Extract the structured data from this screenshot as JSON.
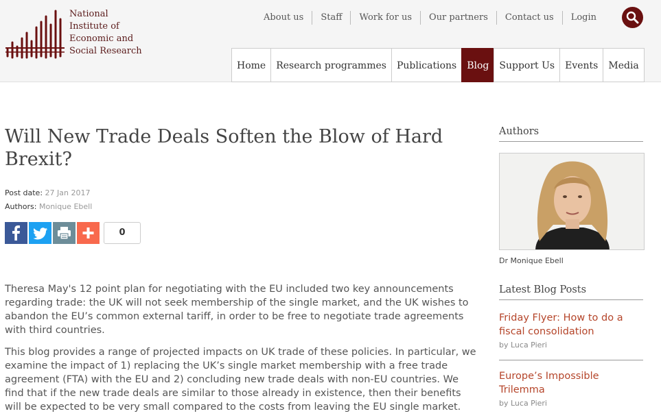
{
  "logo": {
    "line1": "National",
    "line2": "Institute of",
    "line3": "Economic and",
    "line4": "Social Research"
  },
  "topnav": [
    "About us",
    "Staff",
    "Work for us",
    "Our partners",
    "Contact us",
    "Login"
  ],
  "mainnav": {
    "items": [
      "Home",
      "Research programmes",
      "Publications",
      "Blog",
      "Support Us",
      "Events",
      "Media"
    ],
    "active": "Blog"
  },
  "article": {
    "title": "Will New Trade Deals Soften the Blow of Hard Brexit?",
    "post_date_label": "Post date:",
    "post_date": "27 Jan 2017",
    "authors_label": "Authors:",
    "authors": "Monique Ebell",
    "share_count": "0",
    "paragraphs": [
      "Theresa May's 12 point plan for negotiating with the EU included two key announcements regarding trade: the UK will not seek membership of the single market, and the UK wishes to abandon the EU’s common external tariff, in order to be free to negotiate trade agreements with third countries.",
      "This blog provides a range of projected impacts on UK trade of these policies. In particular, we examine the impact of 1) replacing the UK’s single market membership with a free trade agreement (FTA) with the EU and 2) concluding new trade deals with non-EU countries. We find that if the new trade deals are similar to those already in existence, then their benefits will be expected to be very small compared to the costs from leaving the EU single market."
    ]
  },
  "sidebar": {
    "authors_heading": "Authors",
    "author_name": "Dr Monique Ebell",
    "latest_heading": "Latest Blog Posts",
    "posts": [
      {
        "title": "Friday Flyer: How to do a fiscal consolidation",
        "by": "by Luca Pieri"
      },
      {
        "title": "Europe’s Impossible Trilemma",
        "by": "by Luca Pieri"
      }
    ]
  },
  "colors": {
    "brand": "#6a1010",
    "link": "#b5452a",
    "facebook": "#3b5998",
    "twitter": "#1da1f2",
    "print": "#6d8d99",
    "addthis": "#f8694d"
  },
  "icons": {
    "search": "search-icon",
    "facebook": "facebook-icon",
    "twitter": "twitter-icon",
    "print": "print-icon",
    "share": "plus-icon"
  }
}
